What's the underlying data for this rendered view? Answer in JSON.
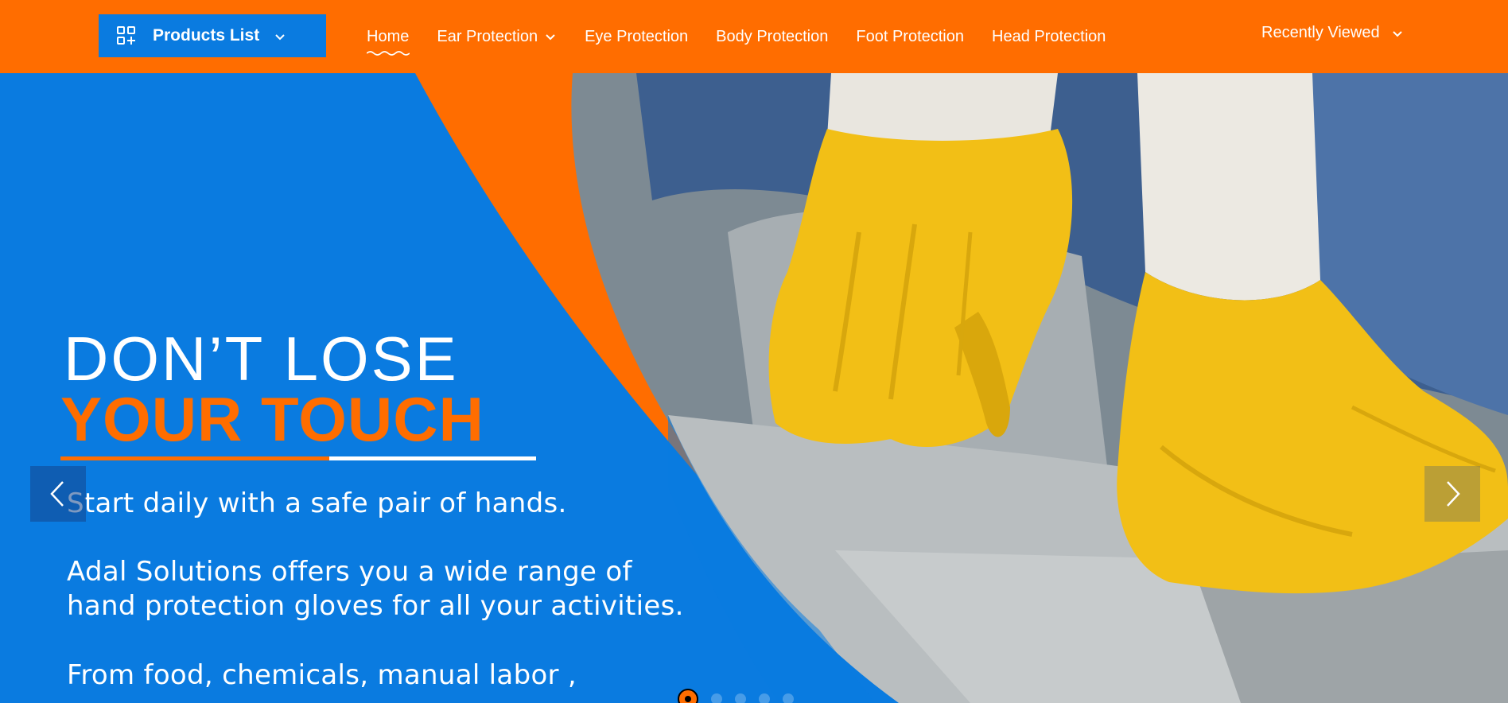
{
  "nav": {
    "products_label": "Products List",
    "items": [
      {
        "label": "Home",
        "active": true,
        "dropdown": false
      },
      {
        "label": "Ear Protection",
        "active": false,
        "dropdown": true
      },
      {
        "label": "Eye Protection",
        "active": false,
        "dropdown": false
      },
      {
        "label": "Body Protection",
        "active": false,
        "dropdown": false
      },
      {
        "label": "Foot Protection",
        "active": false,
        "dropdown": false
      },
      {
        "label": "Head Protection",
        "active": false,
        "dropdown": false
      }
    ],
    "recent_label": "Recently Viewed"
  },
  "hero": {
    "headline_line1": "DON’T LOSE",
    "headline_line2": "YOUR TOUCH",
    "copy1": "Start daily with a safe pair of hands.",
    "copy2_line1": "Adal Solutions offers you a wide range of",
    "copy2_line2": "hand protection gloves for all your activities.",
    "copy3": "From food, chemicals, manual labor ,",
    "slide_count": 5,
    "active_slide": 1
  },
  "colors": {
    "brand_orange": "#ff6d00",
    "brand_blue": "#0a7be0",
    "glove_yellow": "#f2bf16"
  },
  "icons": {
    "products": "grid-plus-icon",
    "dropdown": "chevron-down-icon",
    "prev": "chevron-left-icon",
    "next": "chevron-right-icon"
  }
}
